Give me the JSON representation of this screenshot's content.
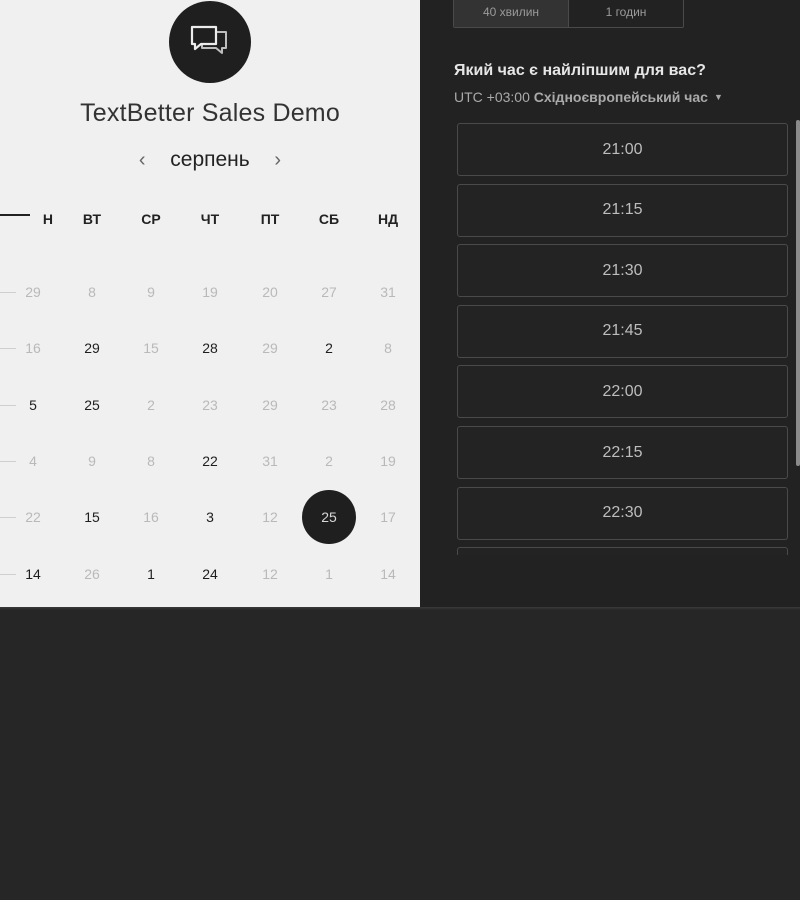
{
  "event": {
    "title": "TextBetter Sales Demo",
    "logo_icon": "chat-bubbles-icon"
  },
  "calendar": {
    "month": "серпень",
    "prev_icon": "chevron-left-icon",
    "next_icon": "chevron-right-icon",
    "weekdays": [
      "ПН",
      "ВТ",
      "СР",
      "ЧТ",
      "ПТ",
      "СБ",
      "НД"
    ],
    "weekday_first_visible": "Н",
    "rows": [
      [
        {
          "d": "29",
          "s": "dim"
        },
        {
          "d": "8",
          "s": "dim"
        },
        {
          "d": "9",
          "s": "dim"
        },
        {
          "d": "19",
          "s": "dim"
        },
        {
          "d": "20",
          "s": "dim"
        },
        {
          "d": "27",
          "s": "dim"
        },
        {
          "d": "31",
          "s": "dim"
        }
      ],
      [
        {
          "d": "16",
          "s": "dim"
        },
        {
          "d": "29",
          "s": "bold"
        },
        {
          "d": "15",
          "s": "dim"
        },
        {
          "d": "28",
          "s": "bold"
        },
        {
          "d": "29",
          "s": "dim"
        },
        {
          "d": "2",
          "s": "bold"
        },
        {
          "d": "8",
          "s": "dim"
        }
      ],
      [
        {
          "d": "5",
          "s": "bold"
        },
        {
          "d": "25",
          "s": "bold"
        },
        {
          "d": "2",
          "s": "dim"
        },
        {
          "d": "23",
          "s": "dim"
        },
        {
          "d": "29",
          "s": "dim"
        },
        {
          "d": "23",
          "s": "dim"
        },
        {
          "d": "28",
          "s": "dim"
        }
      ],
      [
        {
          "d": "4",
          "s": "dim"
        },
        {
          "d": "9",
          "s": "dim"
        },
        {
          "d": "8",
          "s": "dim"
        },
        {
          "d": "22",
          "s": "bold"
        },
        {
          "d": "31",
          "s": "dim"
        },
        {
          "d": "2",
          "s": "dim"
        },
        {
          "d": "19",
          "s": "dim"
        }
      ],
      [
        {
          "d": "22",
          "s": "dim"
        },
        {
          "d": "15",
          "s": "bold"
        },
        {
          "d": "16",
          "s": "dim"
        },
        {
          "d": "3",
          "s": "bold"
        },
        {
          "d": "12",
          "s": "dim"
        },
        {
          "d": "25",
          "s": "selected"
        },
        {
          "d": "17",
          "s": "dim"
        }
      ],
      [
        {
          "d": "14",
          "s": "bold"
        },
        {
          "d": "26",
          "s": "dim"
        },
        {
          "d": "1",
          "s": "bold"
        },
        {
          "d": "24",
          "s": "bold"
        },
        {
          "d": "12",
          "s": "dim"
        },
        {
          "d": "1",
          "s": "dim"
        },
        {
          "d": "14",
          "s": "dim"
        }
      ]
    ]
  },
  "durations": [
    {
      "label": "40 хвилин",
      "active": true
    },
    {
      "label": "1 годин",
      "active": false
    }
  ],
  "time_picker": {
    "question": "Який час є найліпшим для вас?",
    "tz_offset": "UTC +03:00",
    "tz_name": "Східноєвропейський час",
    "tz_caret_icon": "caret-down-icon",
    "slots": [
      "21:00",
      "21:15",
      "21:30",
      "21:45",
      "22:00",
      "22:15",
      "22:30",
      ""
    ]
  }
}
